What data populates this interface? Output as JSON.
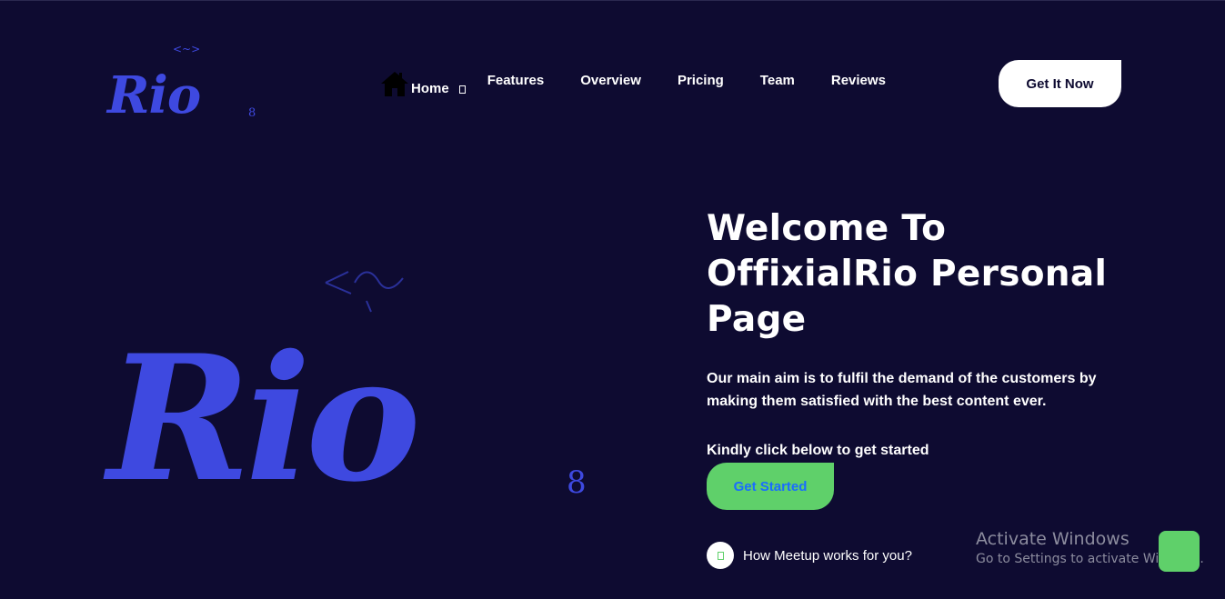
{
  "header": {
    "logo": {
      "text": "Rio",
      "sub": "8"
    },
    "nav": {
      "items": [
        {
          "label": "Home"
        },
        {
          "label": "Features"
        },
        {
          "label": "Overview"
        },
        {
          "label": "Pricing"
        },
        {
          "label": "Team"
        },
        {
          "label": "Reviews"
        }
      ]
    },
    "cta_label": "Get It Now"
  },
  "hero": {
    "logo": {
      "text": "Rio",
      "sub": "8"
    },
    "title": "Welcome To OffixialRio Personal Page",
    "description": "Our main aim is to fulfil the demand of the customers by making them satisfied with the best content ever.",
    "hint": "Kindly click below to get started",
    "cta_label": "Get Started",
    "how_label": "How Meetup works for you?"
  },
  "watermark": {
    "title": "Activate Windows",
    "subtitle": "Go to Settings to activate Windows."
  },
  "colors": {
    "background": "#0e0b31",
    "brand_blue": "#3e49e0",
    "accent_green": "#5fd06a",
    "button_text_blue": "#1a6cff",
    "white": "#ffffff"
  },
  "icons": {
    "home": "home-icon",
    "dropdown": "dropdown-icon",
    "play": "play-icon"
  }
}
